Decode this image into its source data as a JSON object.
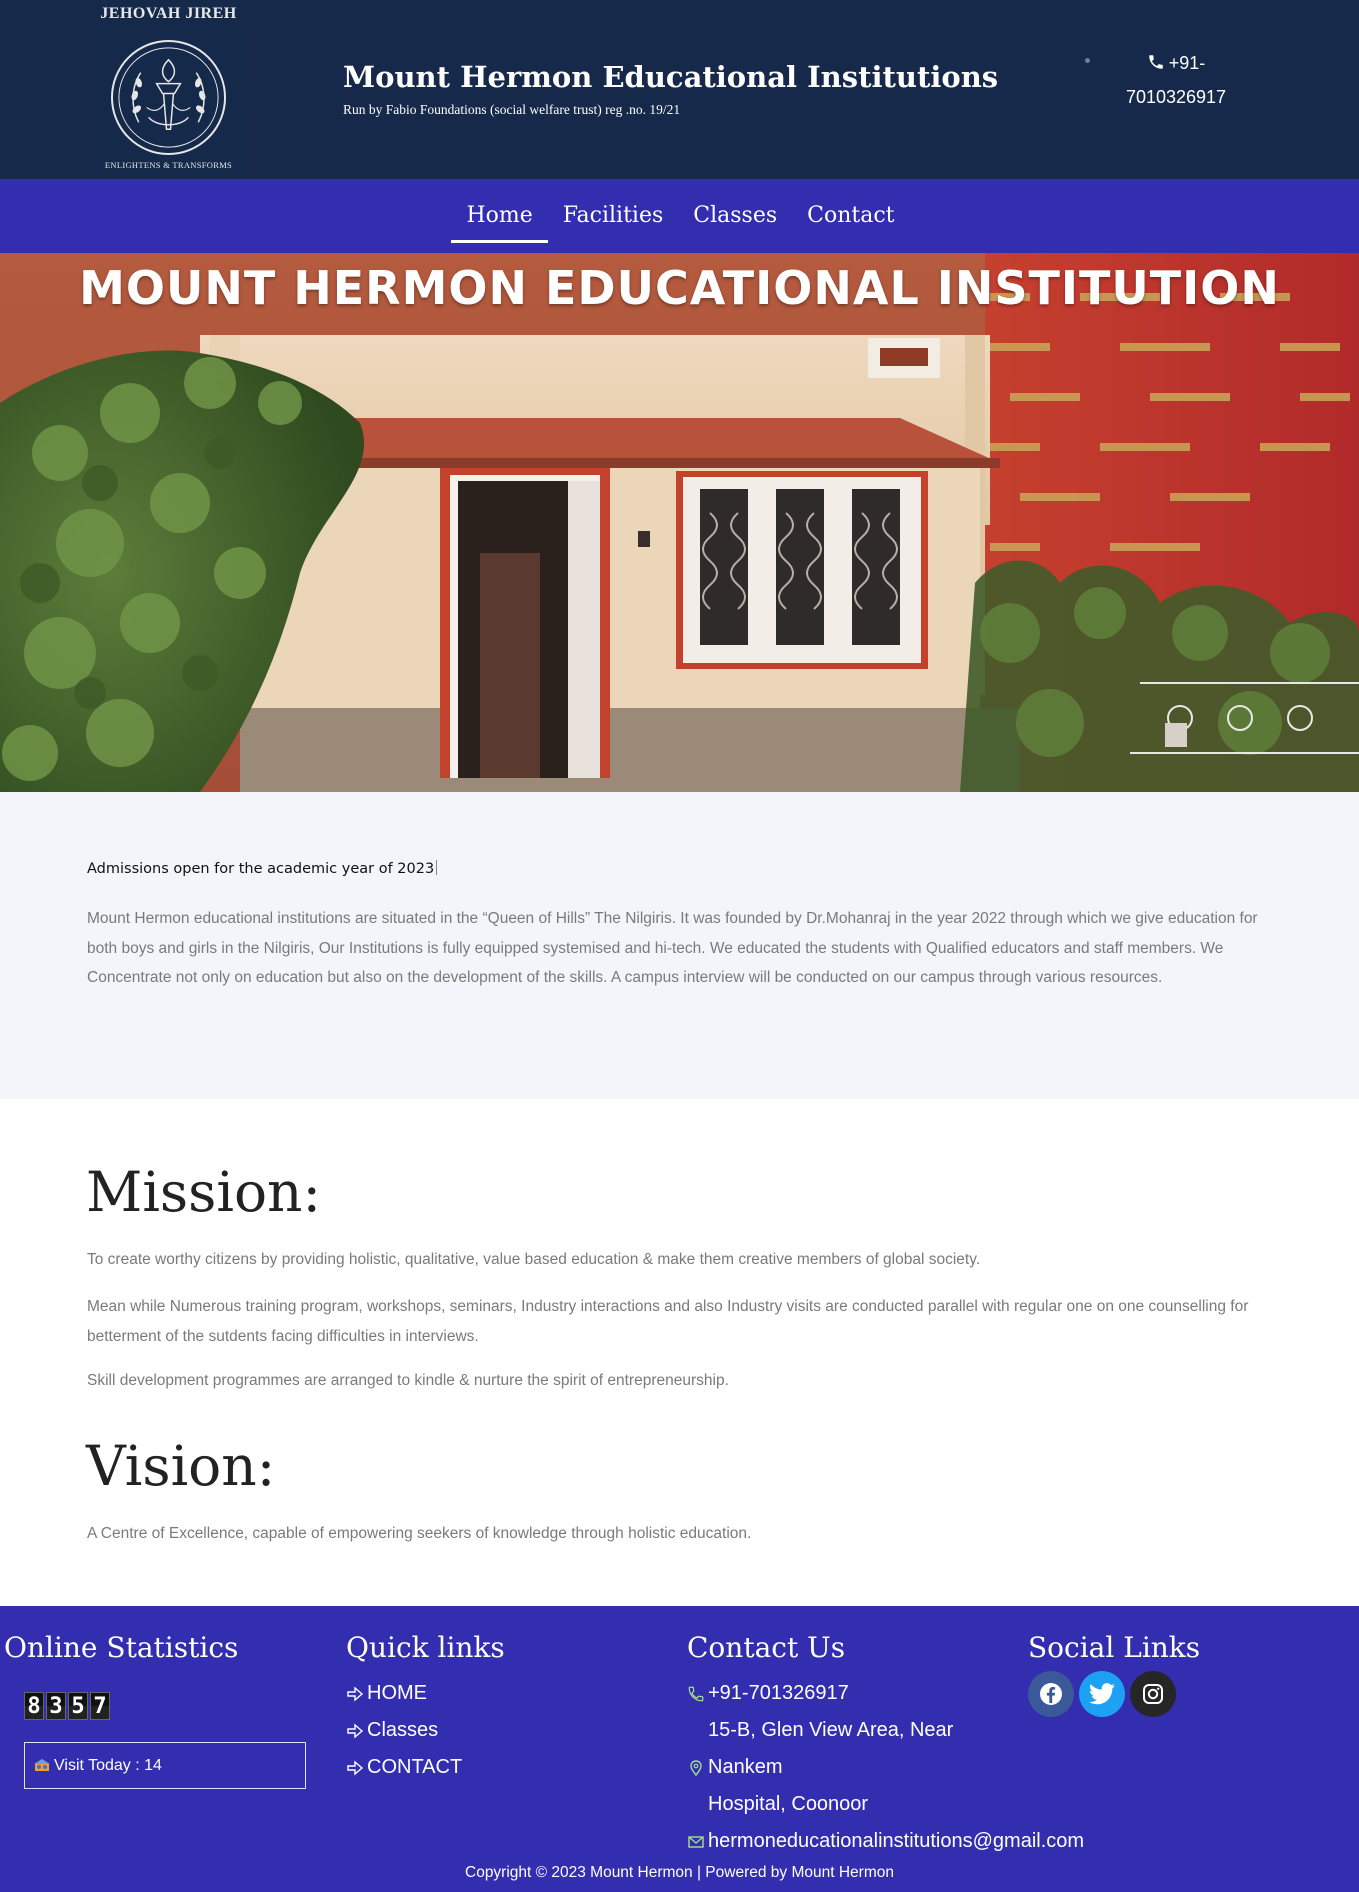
{
  "header": {
    "logo_top_text": "JEHOVAH JIREH",
    "logo_bottom_text": "ENLIGHTENS & TRANSFORMS",
    "title": "Mount Hermon Educational Institutions",
    "subtitle": "Run by Fabio Foundations (social welfare trust) reg .no. 19/21",
    "phone_line1": "+91-",
    "phone_line2": "7010326917",
    "bg_color": "#16294a"
  },
  "nav": {
    "bg_color": "#332db0",
    "items": [
      {
        "label": "Home",
        "active": true
      },
      {
        "label": "Facilities",
        "active": false
      },
      {
        "label": "Classes",
        "active": false
      },
      {
        "label": "Contact",
        "active": false
      }
    ]
  },
  "hero": {
    "title": "MOUNT HERMON EDUCATIONAL INSTITUTION"
  },
  "intro": {
    "heading": "Admissions open for the academic year of 2023",
    "body": "Mount Hermon educational institutions are situated in the “Queen of Hills” The Nilgiris. It was founded by Dr.Mohanraj in the year 2022 through which we give education for both boys and girls in the Nilgiris, Our Institutions is fully equipped systemised and hi-tech. We educated the students with Qualified educators and staff members. We Concentrate not only on education but also on the development of the skills. A campus interview will be conducted on our campus through various resources."
  },
  "mission": {
    "title": "Mission:",
    "p1": "To create worthy citizens by providing holistic, qualitative, value based education & make them creative members of global society.",
    "p2": "Mean while Numerous training program, workshops, seminars, Industry interactions and also Industry visits are conducted parallel with regular one on one counselling for betterment of the sutdents facing difficulties in interviews.",
    "p3": "Skill development programmes are arranged to kindle & nurture the spirit of entrepreneurship."
  },
  "vision": {
    "title": "Vision:",
    "p1": "A Centre of Excellence, capable of empowering seekers of knowledge through holistic education."
  },
  "footer": {
    "bg_color": "#332db0",
    "stats_title": "Online Statistics",
    "counter_digits": [
      "8",
      "3",
      "5",
      "7"
    ],
    "visit_today": "Visit Today : 14",
    "quick_title": "Quick links",
    "quick_links": [
      "HOME",
      "Classes",
      "CONTACT"
    ],
    "contact_title": "Contact Us",
    "contact_phone": "+91-701326917",
    "contact_addr_line1": "15-B, Glen View Area, Near Nankem",
    "contact_addr_line2": "Hospital, Coonoor",
    "contact_email": "hermoneducationalinstitutions@gmail.com",
    "social_title": "Social Links",
    "social": [
      "facebook-icon",
      "twitter-icon",
      "instagram-icon"
    ],
    "copyright": "Copyright © 2023 Mount Hermon | Powered by Mount Hermon"
  }
}
